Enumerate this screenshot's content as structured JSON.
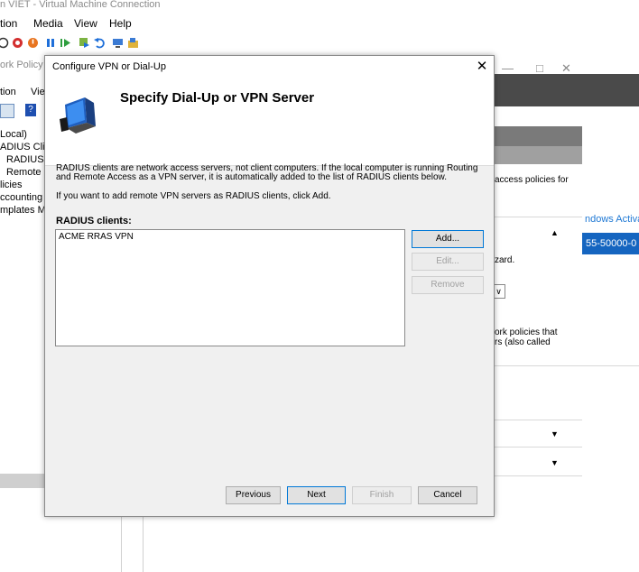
{
  "vm": {
    "title": "n VIET - Virtual Machine Connection",
    "menu": [
      "tion",
      "Media",
      "View",
      "Help"
    ]
  },
  "background": {
    "mmc_title": "ork Policy",
    "mmc_menu": [
      "tion",
      "Vie"
    ],
    "tree": [
      "Local)",
      "ADIUS Clier",
      "RADIUS C",
      "Remote F",
      "licies",
      "ccounting",
      "mplates M"
    ],
    "right_snippets": {
      "access_policies": "access policies for",
      "windows_activation": "ndows Activa",
      "selected_text": "55-50000-0",
      "wizard": "zard.",
      "policies_that": "ork policies that",
      "also_called": "rs (also called"
    }
  },
  "dialog": {
    "title": "Configure VPN or Dial-Up",
    "heading": "Specify Dial-Up or VPN Server",
    "description": "RADIUS clients are network access servers, not client computers. If the local computer is running Routing and Remote Access as a VPN server, it is automatically added to the list of RADIUS clients below.",
    "instruction": "If you want to add remote VPN servers as RADIUS clients, click Add.",
    "list_label": "RADIUS clients:",
    "list_items": [
      "ACME RRAS VPN"
    ],
    "buttons": {
      "add": "Add...",
      "edit": "Edit...",
      "remove": "Remove",
      "previous": "Previous",
      "next": "Next",
      "finish": "Finish",
      "cancel": "Cancel"
    }
  }
}
